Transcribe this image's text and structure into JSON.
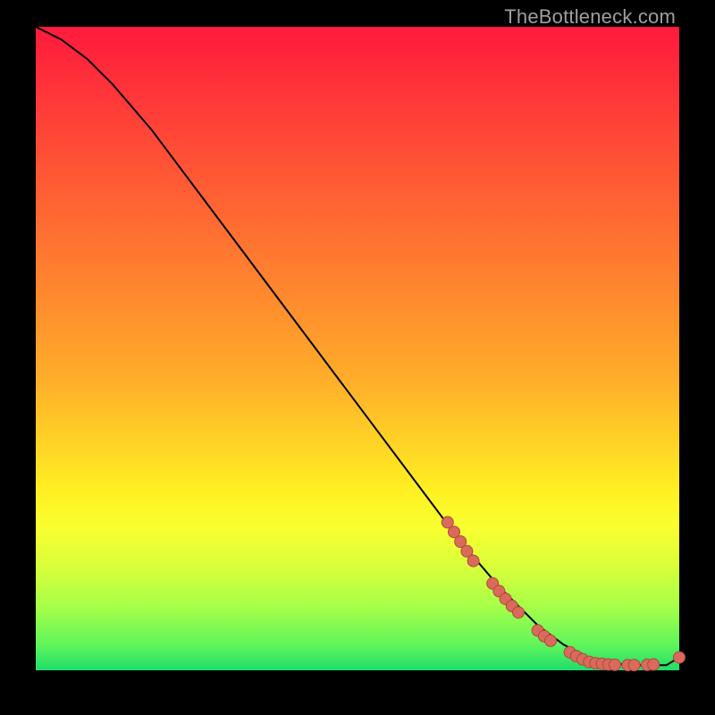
{
  "watermark": "TheBottleneck.com",
  "colors": {
    "curve_stroke": "#000000",
    "marker_fill": "#d96a5c",
    "marker_stroke": "#b0493d"
  },
  "chart_data": {
    "type": "line",
    "title": "",
    "xlabel": "",
    "ylabel": "",
    "xlim": [
      0,
      100
    ],
    "ylim": [
      0,
      100
    ],
    "grid": false,
    "series": [
      {
        "name": "curve",
        "x": [
          0,
          4,
          8,
          12,
          18,
          24,
          30,
          36,
          42,
          48,
          54,
          60,
          66,
          72,
          78,
          82,
          86,
          90,
          94,
          98,
          100
        ],
        "y": [
          100,
          98,
          95,
          91,
          84,
          76,
          68,
          60,
          52,
          44,
          36,
          28,
          20,
          13,
          7,
          4,
          2,
          1,
          0.8,
          0.8,
          2
        ]
      }
    ],
    "markers": [
      {
        "x": 64,
        "y": 23
      },
      {
        "x": 65,
        "y": 21.5
      },
      {
        "x": 66,
        "y": 20
      },
      {
        "x": 67,
        "y": 18.5
      },
      {
        "x": 68,
        "y": 17
      },
      {
        "x": 71,
        "y": 13.5
      },
      {
        "x": 72,
        "y": 12.3
      },
      {
        "x": 73,
        "y": 11.1
      },
      {
        "x": 74,
        "y": 10
      },
      {
        "x": 75,
        "y": 9
      },
      {
        "x": 78,
        "y": 6.2
      },
      {
        "x": 79,
        "y": 5.3
      },
      {
        "x": 80,
        "y": 4.6
      },
      {
        "x": 83,
        "y": 2.8
      },
      {
        "x": 84,
        "y": 2.2
      },
      {
        "x": 85,
        "y": 1.7
      },
      {
        "x": 86,
        "y": 1.3
      },
      {
        "x": 87,
        "y": 1.1
      },
      {
        "x": 88,
        "y": 1.0
      },
      {
        "x": 89,
        "y": 0.9
      },
      {
        "x": 90,
        "y": 0.85
      },
      {
        "x": 92,
        "y": 0.8
      },
      {
        "x": 93,
        "y": 0.8
      },
      {
        "x": 95,
        "y": 0.85
      },
      {
        "x": 96,
        "y": 0.9
      },
      {
        "x": 100,
        "y": 2.0
      }
    ]
  }
}
